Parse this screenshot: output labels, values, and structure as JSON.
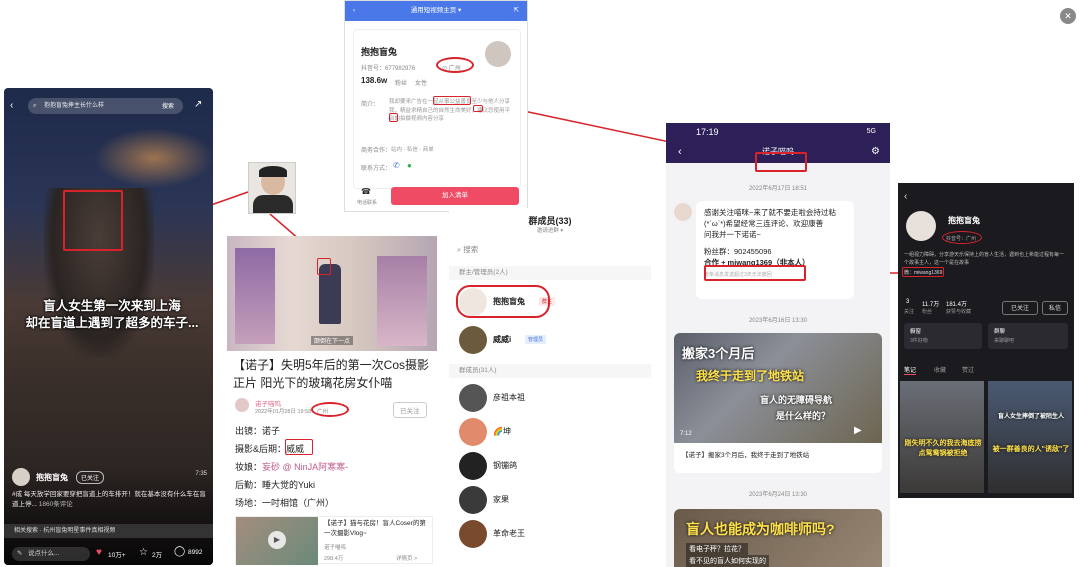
{
  "p1": {
    "search": "抱抱盲兔摔主长什么样",
    "search_btn": "搜索",
    "caption_line1": "盲人女生第一次来到上海",
    "caption_line2": "却在盲道上遇到了超多的车子...",
    "author": "抱抱盲兔",
    "follow": "已关注",
    "desc": "#成 每天放学回家要穿把盲道上的车排开！就在基本没有什么车在盲道上停...",
    "desc_more": "1860条评论",
    "related": "相关搜索 · 杭州盲兔明星事件真相视频",
    "comment_ph": "说点什么...",
    "likes": "10万+",
    "stars": "2万",
    "comments": "8992",
    "time": "7:35"
  },
  "p2": {
    "header": "通用短视频主页",
    "name": "抱抱盲兔",
    "id_label": "抖音号：",
    "id_value": "677982976",
    "location": "广州",
    "fans": "138.6w",
    "fans_label": "粉丝",
    "gender": "女性",
    "intro_label": "简介：",
    "intro": "我却要来广告在一起从事公益善良至少与他人分享我，精益求精自己的自然生命美好，建议您使用平台的拍摄视频内容分享",
    "coop_label": "商务合作：",
    "coop": "站内 · 私信 · 商单",
    "contact_label": "联系方式：",
    "phone": "电话联系",
    "add_btn": "加入清单"
  },
  "p4": {
    "caption_in_img": "颠倒在下一点",
    "title": "【诺子】失明5年后的第一次Cos摄影正片 阳光下的玻璃花房女仆喵",
    "author": "诺子喵呜",
    "date": "2022年01月28日 19:58",
    "location": "广州",
    "follow": "已关注",
    "rows": [
      {
        "k": "出镜：",
        "v": "诺子"
      },
      {
        "k": "摄影&后期：",
        "v": "威威"
      },
      {
        "k": "妆娘：",
        "v": "妄砂 @ NinJA阿寒寒-"
      },
      {
        "k": "后勤：",
        "v": "睡大觉的Yuki"
      },
      {
        "k": "场地：",
        "v": "一吋相馆（广州）"
      }
    ],
    "rel_title": "【诺子】猫与花房！盲人Coser的第一次摄影Vlog~",
    "rel_author": "诺子喵呜",
    "rel_views": "298.4万",
    "rel_more": "详情页 >"
  },
  "p5": {
    "title": "群成员(33)",
    "sub": "邀请进群 ▾",
    "search": "搜索",
    "admin_head": "群主/管理员(2人)",
    "admins": [
      {
        "name": "抱抱盲兔",
        "badge": "群主"
      },
      {
        "name": "威威i",
        "badge": "管理员"
      }
    ],
    "member_head": "群成员(31人)",
    "members": [
      "彦祖本祖",
      "🌈坤",
      "钢镚鸽",
      "家果",
      "革命老王"
    ]
  },
  "p6": {
    "time": "17:19",
    "signal": "5G",
    "nav_title": "诺子喵呜",
    "date1": "2022年6月17日 18:51",
    "msg_line1": "感谢关注喵咪~来了就不要走啦会持过粘",
    "msg_line2": "(*´ω`*)希望经常三连评论、欢迎康善",
    "msg_line3": "问我并一下诺诺~",
    "fan_label": "粉丝群：902455096",
    "coop": "合作 + miwang1369（非本人）",
    "msg_foot": "该条消息发送超过3天无法撤回",
    "date2": "2023年6月16日 13:30",
    "card1_text1": "搬家3个月后",
    "card1_text2": "我终于走到了地铁站",
    "card1_text3": "盲人的无障碍导航",
    "card1_text4": "是什么样的？",
    "card1_dur": "7:12",
    "card1_title": "【诺子】搬家3个月后，我终于走到了地铁站",
    "date3": "2023年6月24日 13:30",
    "card2_text1": "盲人也能成为咖啡师吗?",
    "card2_text2": "看电子秤？拉花？",
    "card2_text3": "看不见的盲人如何实现的"
  },
  "p7": {
    "name": "抱抱盲兔",
    "id": "抖音号：广州",
    "intro": "一组视力障碍，分享游天乐保持上的盲人生活，遇到也上希能过程有每一个故事主人，这一个是在故事",
    "wx": "微：miwang1369",
    "follow_n": "3",
    "follow_l": "关注",
    "fans_n": "11.7万",
    "fans_l": "粉丝",
    "likes_n": "181.4万",
    "likes_l": "获赞与收藏",
    "follow_btn": "已关注",
    "msg_btn": "私信",
    "shop": "橱窗",
    "shop_sub": "3件好物",
    "group": "群聊",
    "group_sub": "来聊聊吧",
    "tabs": [
      "笔记",
      "收藏",
      "赞过"
    ],
    "note1": "刚失明不久的我去海底捞点鸳鸯锅被拒绝",
    "note2": "被一群善良的人\"诱敌\"了",
    "note2_top": "盲人女生摔倒了被陌生人"
  }
}
